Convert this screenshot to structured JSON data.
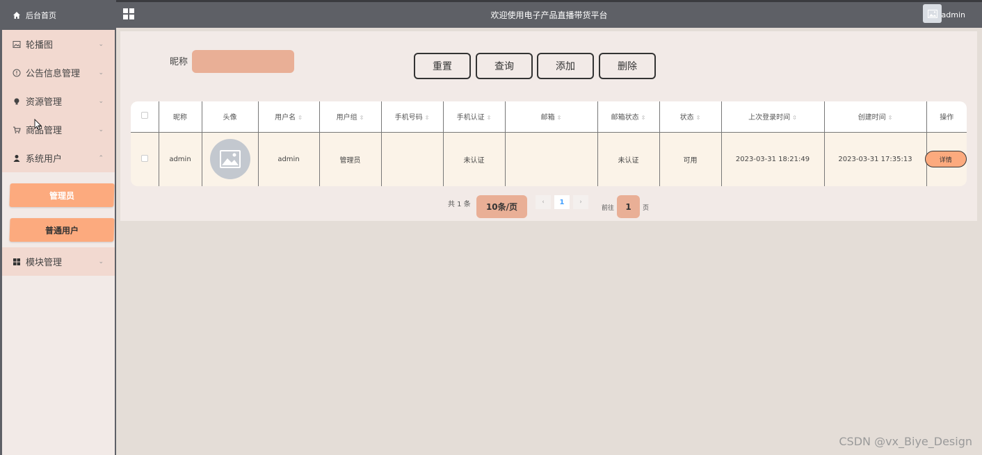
{
  "sidebar": {
    "home": "后台首页",
    "items": [
      {
        "label": "轮播图",
        "icon": "image-icon"
      },
      {
        "label": "公告信息管理",
        "icon": "info-circle-icon"
      },
      {
        "label": "资源管理",
        "icon": "bulb-icon"
      },
      {
        "label": "商品管理",
        "icon": "cart-icon"
      },
      {
        "label": "系统用户",
        "icon": "user-icon"
      },
      {
        "label": "模块管理",
        "icon": "grid-icon"
      }
    ],
    "submenu": [
      "管理员",
      "普通用户"
    ]
  },
  "header": {
    "title": "欢迎使用电子产品直播带货平台",
    "user": "admin"
  },
  "filter": {
    "label": "昵称",
    "placeholder": ""
  },
  "buttons": {
    "reset": "重置",
    "query": "查询",
    "add": "添加",
    "delete": "删除"
  },
  "table": {
    "columns": [
      "昵称",
      "头像",
      "用户名",
      "用户组",
      "手机号码",
      "手机认证",
      "邮箱",
      "邮箱状态",
      "状态",
      "上次登录时间",
      "创建时间",
      "操作"
    ],
    "rows": [
      {
        "nickname": "admin",
        "username": "admin",
        "group": "管理员",
        "phone": "",
        "phone_verify": "未认证",
        "email": "",
        "email_status": "未认证",
        "status": "可用",
        "last_login": "2023-03-31 18:21:49",
        "created": "2023-03-31 17:35:13",
        "action": "详情"
      }
    ]
  },
  "pager": {
    "total": "共 1 条",
    "page_size": "10条/页",
    "current": "1",
    "goto": "前往",
    "goto_page": "1",
    "unit": "页"
  },
  "watermark": "CSDN @vx_Biye_Design",
  "colors": {
    "header_bg": "#5e6066",
    "accent": "#fcaa7e",
    "input_bg": "#e9af96",
    "menu_bg": "#f2d9d0",
    "panel_bg": "#f2eae7"
  }
}
